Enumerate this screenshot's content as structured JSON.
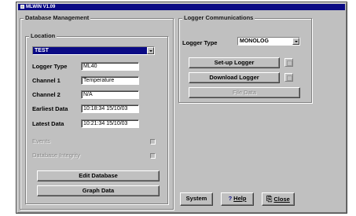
{
  "window": {
    "title": "MLWIN V1.09"
  },
  "database": {
    "title": "Database Management",
    "location": {
      "title": "Location",
      "selected": "TEST",
      "logger_type_label": "Logger Type",
      "logger_type_value": "ML40",
      "channel1_label": "Channel 1",
      "channel1_value": "Temperature",
      "channel2_label": "Channel 2",
      "channel2_value": "N/A",
      "earliest_label": "Earliest Data",
      "earliest_value": "10:18:34  15/10/03",
      "latest_label": "Latest Data",
      "latest_value": "10:21:34  15/10/03",
      "events_label": "Events",
      "integrity_label": "Database Integrity",
      "edit_button": "Edit Database",
      "graph_button": "Graph Data"
    }
  },
  "logger": {
    "title": "Logger Communications",
    "type_label": "Logger Type",
    "type_value": "MONOLOG",
    "setup_button": "Set-up Logger",
    "download_button": "Download Logger",
    "file_button": "File Data"
  },
  "footer": {
    "system_button": "System",
    "help_button": "Help",
    "close_button": "Close"
  },
  "icons": {
    "help": "question-mark-icon",
    "close": "exit-door-icon",
    "setup_status": "status-indicator-icon",
    "download_status": "status-indicator-icon"
  }
}
